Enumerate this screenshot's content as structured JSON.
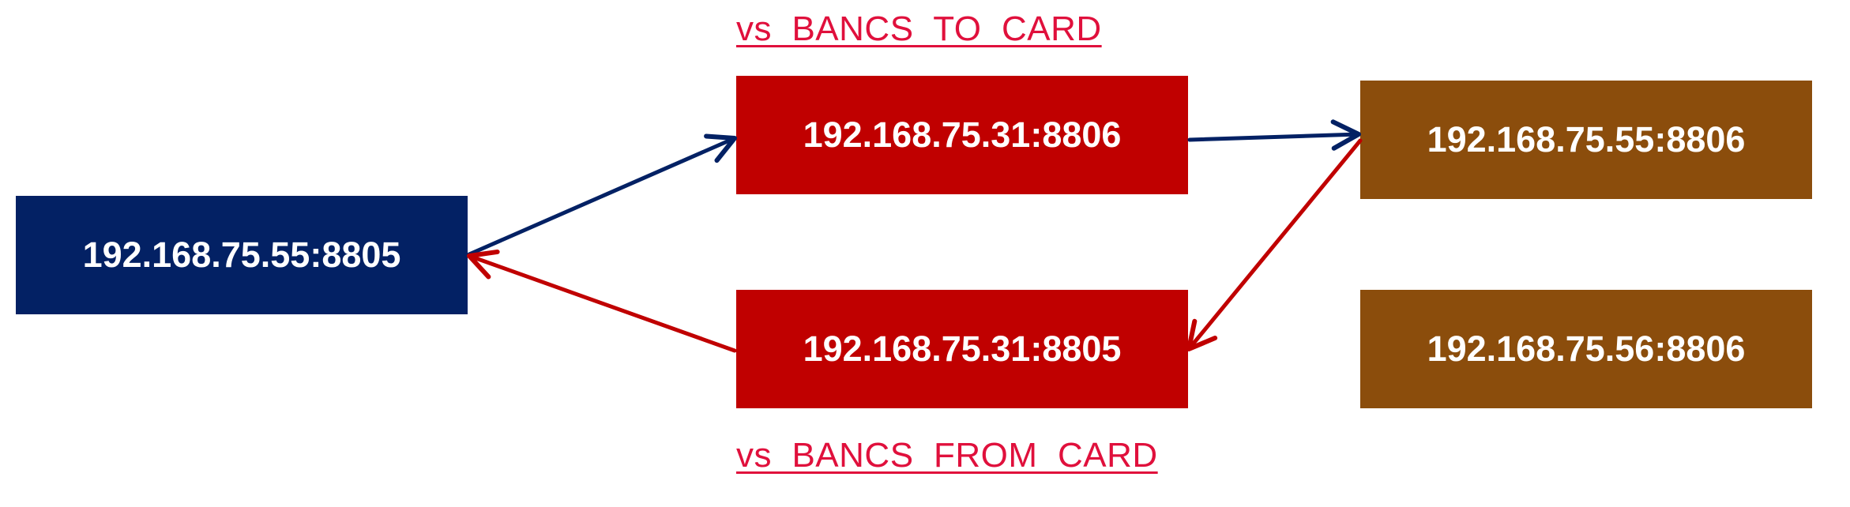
{
  "colors": {
    "navy": "#032164",
    "red": "#c00000",
    "brown": "#8b4d0c",
    "label_red": "#e0103c"
  },
  "labels": {
    "to_card": "vs  BANCS  TO  CARD",
    "from_card": "vs  BANCS  FROM  CARD"
  },
  "nodes": {
    "source": "192.168.75.55:8805",
    "to_card": "192.168.75.31:8806",
    "from_card": "192.168.75.31:8805",
    "dest_55": "192.168.75.55:8806",
    "dest_56": "192.168.75.56:8806"
  },
  "edges": [
    {
      "from": "source",
      "to": "to_card",
      "color": "navy"
    },
    {
      "from": "to_card",
      "to": "dest_55",
      "color": "navy"
    },
    {
      "from": "dest_55",
      "to": "from_card",
      "color": "red"
    },
    {
      "from": "from_card",
      "to": "source",
      "color": "red"
    }
  ]
}
